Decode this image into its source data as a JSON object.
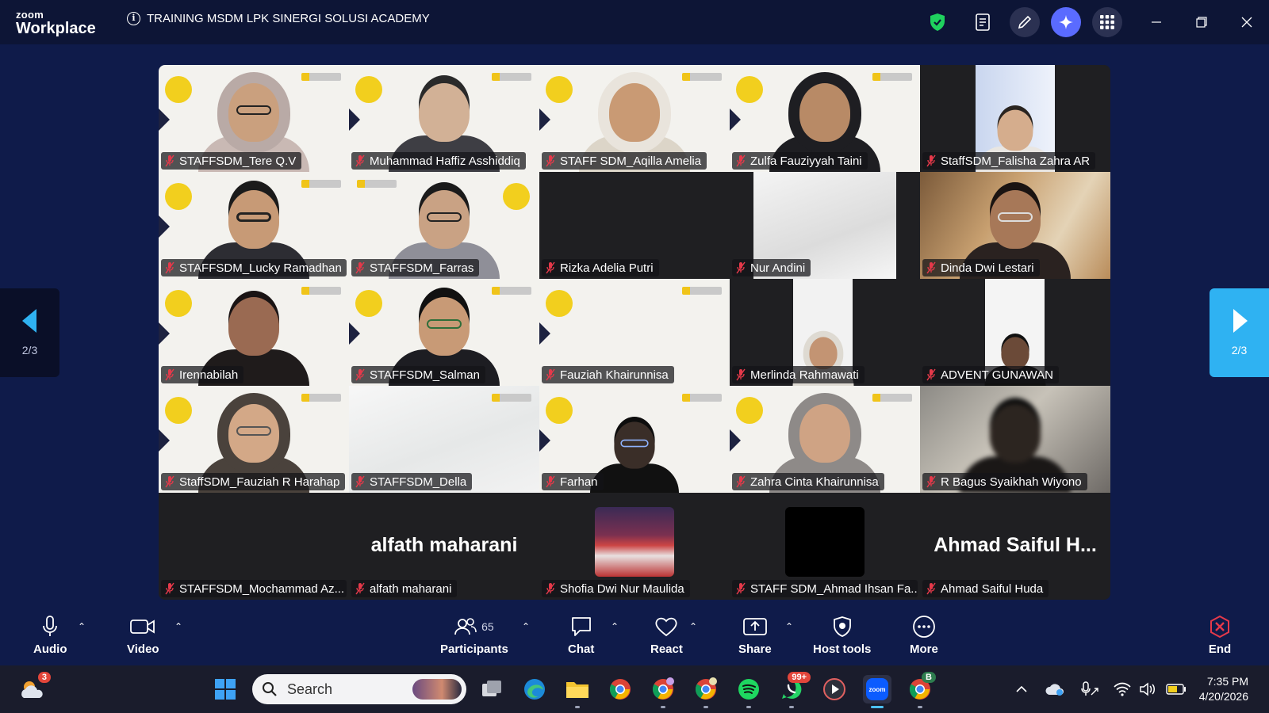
{
  "app": {
    "logo_small": "zoom",
    "logo_big": "Workplace",
    "meeting_title": "TRAINING MSDM LPK SINERGI SOLUSI ACADEMY"
  },
  "pagination": {
    "prev_label": "2/3",
    "next_label": "2/3"
  },
  "participants": [
    {
      "name": "STAFFSDM_Tere Q.V"
    },
    {
      "name": "Muhammad Haffiz Asshiddiq"
    },
    {
      "name": "STAFF SDM_Aqilla Amelia"
    },
    {
      "name": "Zulfa Fauziyyah Taini"
    },
    {
      "name": "StaffSDM_Falisha Zahra AR"
    },
    {
      "name": "STAFFSDM_Lucky Ramadhan"
    },
    {
      "name": "STAFFSDM_Farras"
    },
    {
      "name": "Rizka Adelia Putri"
    },
    {
      "name": "Nur Andini"
    },
    {
      "name": "Dinda Dwi Lestari"
    },
    {
      "name": "Irennabilah"
    },
    {
      "name": "STAFFSDM_Salman"
    },
    {
      "name": "Fauziah Khairunnisa"
    },
    {
      "name": "Merlinda Rahmawati"
    },
    {
      "name": "ADVENT GUNAWAN"
    },
    {
      "name": "StaffSDM_Fauziah R Harahap"
    },
    {
      "name": "STAFFSDM_Della"
    },
    {
      "name": "Farhan"
    },
    {
      "name": "Zahra Cinta Khairunnisa"
    },
    {
      "name": "R Bagus Syaikhah Wiyono"
    },
    {
      "name": "STAFFSDM_Mochammad Az..."
    },
    {
      "name": "alfath maharani",
      "display": "alfath maharani"
    },
    {
      "name": "Shofia Dwi Nur Maulida"
    },
    {
      "name": "STAFF SDM_Ahmad Ihsan Fa..."
    },
    {
      "name": "Ahmad Saiful Huda",
      "display": "Ahmad Saiful H..."
    }
  ],
  "toolbar": {
    "audio": "Audio",
    "video": "Video",
    "participants": "Participants",
    "participants_count": "65",
    "chat": "Chat",
    "react": "React",
    "share": "Share",
    "host_tools": "Host tools",
    "more": "More",
    "end": "End"
  },
  "taskbar": {
    "weather_badge": "3",
    "search_placeholder": "Search",
    "whatsapp_badge": "99+",
    "chrome_profile_badge": "B",
    "time": "7:35 PM",
    "date": "4/20/2026"
  },
  "colors": {
    "meeting_bg": "#0f1b4a",
    "title_bar": "#0d1536",
    "accent_blue": "#2fb2f2",
    "end_red": "#e5394a",
    "muted_red": "#e5394a",
    "virtual_bg_yellow": "#f2cf1e"
  }
}
